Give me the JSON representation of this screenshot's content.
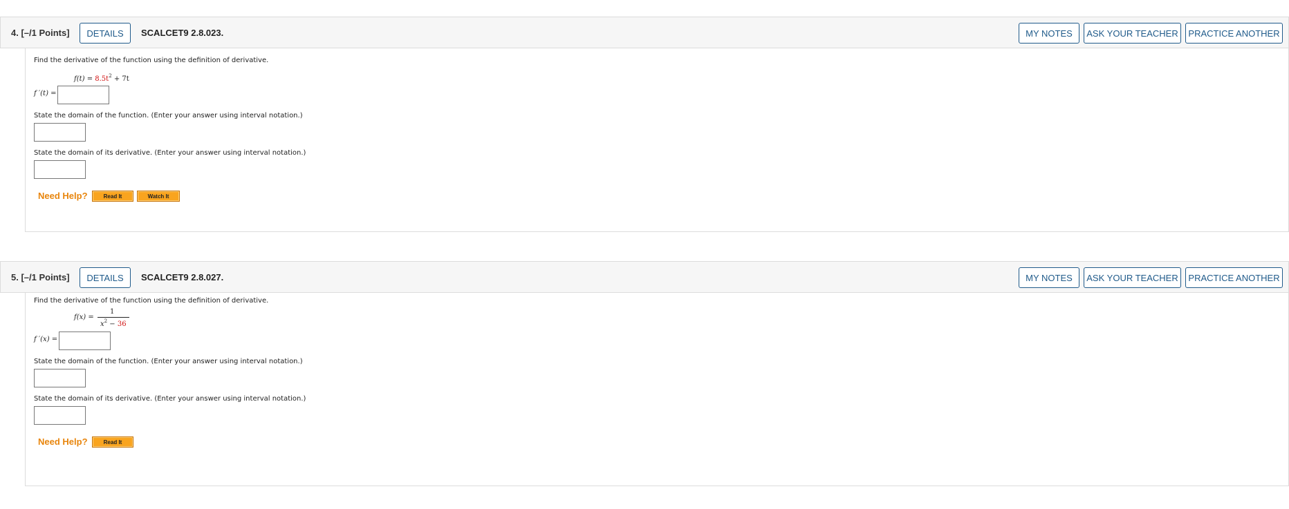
{
  "questions": [
    {
      "number": "4.",
      "points": "[–/1 Points]",
      "details_label": "DETAILS",
      "reference": "SCALCET9 2.8.023.",
      "my_notes_label": "MY NOTES",
      "ask_teacher_label": "ASK YOUR TEACHER",
      "practice_label": "PRACTICE ANOTHER",
      "prompt": "Find the derivative of the function using the definition of derivative.",
      "function": {
        "lhs": "f(t) = ",
        "coef": "8.5t",
        "exp": "2",
        "rest": " + 7t"
      },
      "derivative_label": "f ′(t) =",
      "domain_function_prompt": "State the domain of the function. (Enter your answer using interval notation.)",
      "domain_derivative_prompt": "State the domain of its derivative. (Enter your answer using interval notation.)",
      "need_help": "Need Help?",
      "help_buttons": [
        "Read It",
        "Watch It"
      ]
    },
    {
      "number": "5.",
      "points": "[–/1 Points]",
      "details_label": "DETAILS",
      "reference": "SCALCET9 2.8.027.",
      "my_notes_label": "MY NOTES",
      "ask_teacher_label": "ASK YOUR TEACHER",
      "practice_label": "PRACTICE ANOTHER",
      "prompt": "Find the derivative of the function using the definition of derivative.",
      "function": {
        "lhs": "f(x) = ",
        "numerator": "1",
        "den_var": "x",
        "den_exp": "2",
        "den_minus": " − ",
        "den_const": "36"
      },
      "derivative_label": "f ′(x) =",
      "domain_function_prompt": "State the domain of the function. (Enter your answer using interval notation.)",
      "domain_derivative_prompt": "State the domain of its derivative. (Enter your answer using interval notation.)",
      "need_help": "Need Help?",
      "help_buttons": [
        "Read It"
      ]
    }
  ],
  "colors": {
    "accent_blue": "#1f5a8a",
    "need_help_orange": "#e8850c",
    "help_button": "#f9a41f",
    "highlight_red": "#d01010"
  }
}
